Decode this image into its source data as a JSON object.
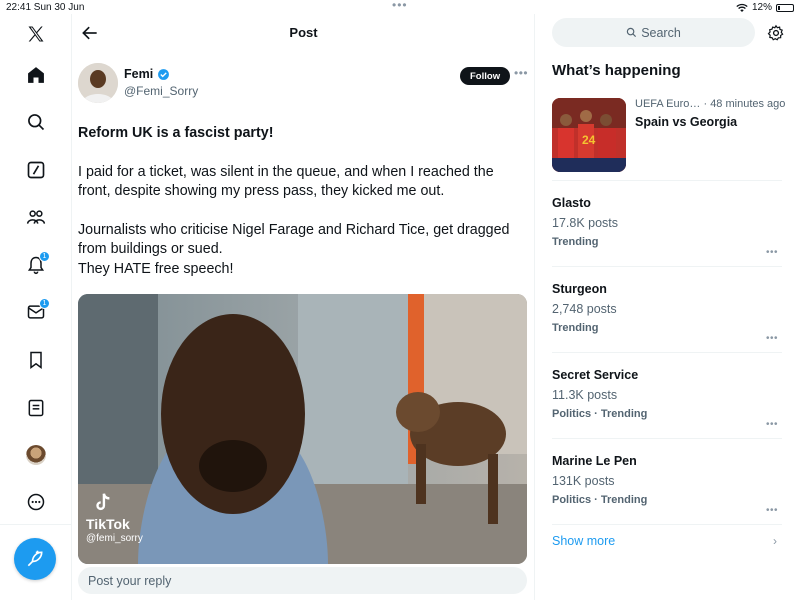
{
  "status_bar": {
    "time_date": "22:41  Sun 30 Jun",
    "battery": "12%"
  },
  "nav": {
    "messages_badge": "1",
    "notifications_badge": "1"
  },
  "header": {
    "title": "Post"
  },
  "post": {
    "author_name": "Femi",
    "author_handle": "@Femi_Sorry",
    "follow_label": "Follow",
    "headline": "Reform UK is a fascist party!",
    "paragraph_1": "I paid for a ticket, was silent in the queue, and when I reached the front, despite showing my press pass, they kicked me out.",
    "paragraph_2a": "Journalists who criticise Nigel Farage and Richard Tice, get dragged from buildings or sued.",
    "paragraph_2b": "They HATE free speech!",
    "media_watermark": "TikTok",
    "media_handle": "@femi_sorry"
  },
  "reply": {
    "placeholder": "Post your reply"
  },
  "sidebar": {
    "search_label": "Search",
    "heading": "What’s happening",
    "featured": {
      "meta": "UEFA Euro… · 48 minutes ago",
      "title": "Spain vs Georgia"
    },
    "trends": [
      {
        "title": "Glasto",
        "count": "17.8K posts",
        "label": "Trending"
      },
      {
        "title": "Sturgeon",
        "count": "2,748 posts",
        "label": "Trending"
      },
      {
        "title": "Secret Service",
        "count": "11.3K posts",
        "label": "Politics · Trending"
      },
      {
        "title": "Marine Le Pen",
        "count": "131K posts",
        "label": "Politics · Trending"
      }
    ],
    "show_more": "Show more"
  },
  "colors": {
    "accent": "#1d9bf0",
    "text": "#0f1419",
    "muted": "#536471",
    "border": "#eff3f4"
  }
}
